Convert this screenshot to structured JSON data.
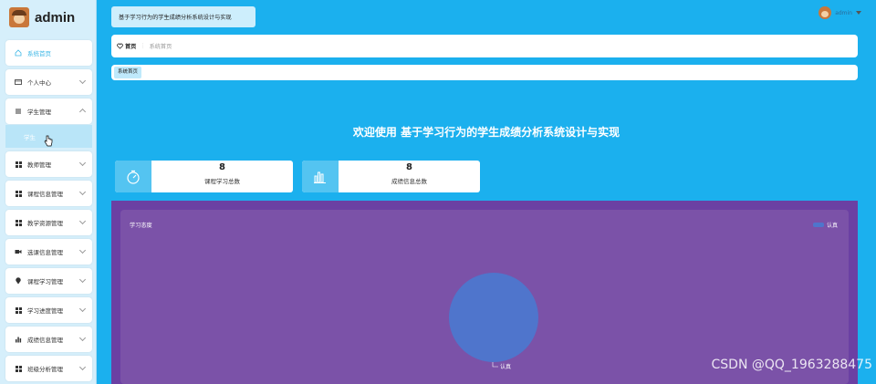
{
  "sidebar": {
    "brand": "admin",
    "items": [
      {
        "label": "系统首页",
        "icon": "home-icon"
      },
      {
        "label": "个人中心",
        "icon": "id-card-icon"
      },
      {
        "label": "学生管理",
        "icon": "list-icon"
      },
      {
        "label": "教师管理",
        "icon": "grid-icon"
      },
      {
        "label": "课程信息管理",
        "icon": "grid-icon"
      },
      {
        "label": "教学资源管理",
        "icon": "grid-icon"
      },
      {
        "label": "选课信息管理",
        "icon": "video-icon"
      },
      {
        "label": "课程学习管理",
        "icon": "location-pin-icon"
      },
      {
        "label": "学习进度管理",
        "icon": "grid-icon"
      },
      {
        "label": "成绩信息管理",
        "icon": "bar-chart-icon"
      },
      {
        "label": "班级分析管理",
        "icon": "grid-icon"
      }
    ],
    "sub_item": "学生"
  },
  "header": {
    "title": "基于学习行为的学生成绩分析系统设计与实现",
    "user": "admin"
  },
  "breadcrumb": {
    "home": "首页",
    "current": "系统首页"
  },
  "tabs": [
    "系统首页"
  ],
  "welcome": "欢迎使用 基于学习行为的学生成绩分析系统设计与实现",
  "stats": [
    {
      "value": "8",
      "label": "课程学习总数",
      "icon": "timer-icon"
    },
    {
      "value": "8",
      "label": "成绩信息总数",
      "icon": "bar-chart-icon"
    }
  ],
  "colors": {
    "accent": "#1bb0ee",
    "chart_bg": "#7b52a8",
    "slice": "#4f75cc"
  },
  "chart_data": {
    "type": "pie",
    "title": "学习态度",
    "categories": [
      "认真"
    ],
    "values": [
      1
    ],
    "legend": "top-right"
  },
  "watermark": "CSDN @QQ_1963288475"
}
